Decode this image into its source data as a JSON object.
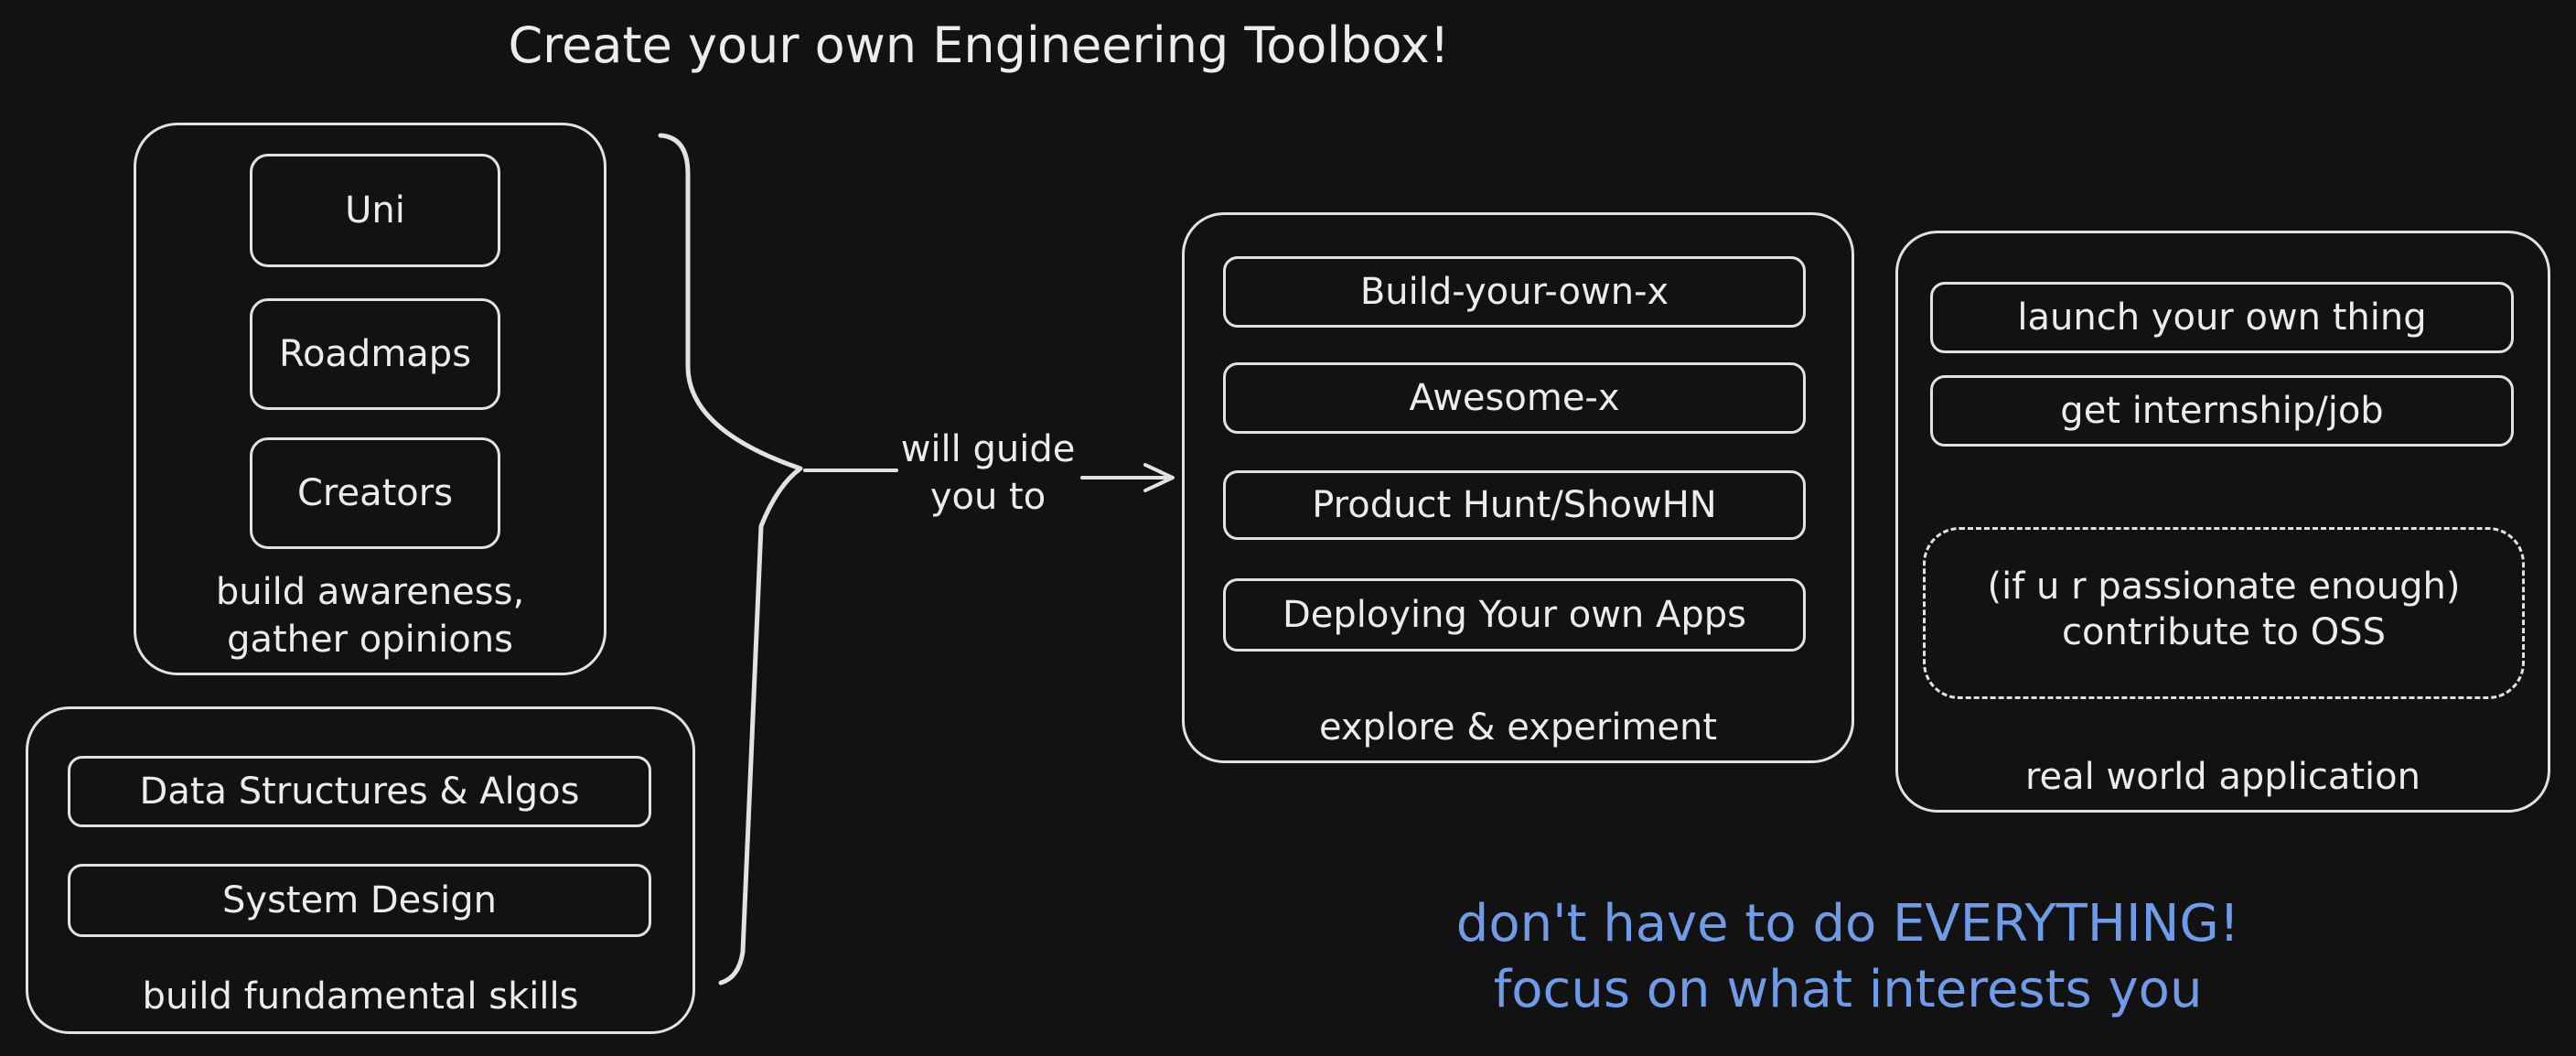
{
  "title": "Create your own Engineering Toolbox!",
  "awareness_group": {
    "items": [
      "Uni",
      "Roadmaps",
      "Creators"
    ],
    "caption_line1": "build awareness,",
    "caption_line2": "gather opinions"
  },
  "fundamentals_group": {
    "items": [
      "Data Structures & Algos",
      "System Design"
    ],
    "caption": "build fundamental skills"
  },
  "connector": {
    "line1": "will guide",
    "line2": "you to"
  },
  "explore_group": {
    "items": [
      "Build-your-own-x",
      "Awesome-x",
      "Product Hunt/ShowHN",
      "Deploying Your own Apps"
    ],
    "caption": "explore & experiment"
  },
  "application_group": {
    "items": [
      "launch your own thing",
      "get internship/job"
    ],
    "optional_line1": "(if u r passionate enough)",
    "optional_line2": "contribute to OSS",
    "caption": "real world application"
  },
  "note": {
    "line1": "don't have to do EVERYTHING!",
    "line2": "focus on what interests you"
  },
  "colors": {
    "background": "#121212",
    "stroke": "#e2e2e2",
    "note": "#6f9be8"
  }
}
